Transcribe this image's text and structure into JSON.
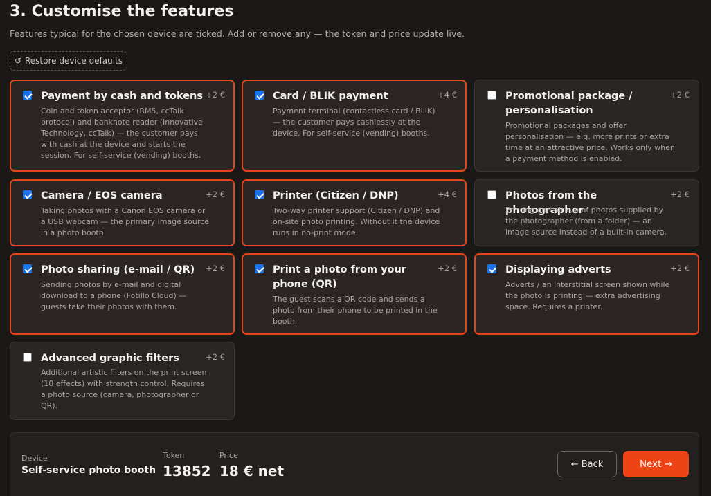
{
  "step": {
    "heading": "3. Customise the features",
    "subtitle": "Features typical for the chosen device are ticked. Add or remove any — the token and price update live.",
    "restore_label": "Restore device defaults"
  },
  "features": [
    {
      "title": "Payment by cash and tokens",
      "price": "+2 €",
      "checked": true,
      "desc": "Coin and token acceptor (RM5, ccTalk protocol) and banknote reader (Innovative Technology, ccTalk) — the customer pays with cash at the device and starts the session. For self-service (vending) booths."
    },
    {
      "title": "Card / BLIK payment",
      "price": "+4 €",
      "checked": true,
      "desc": "Payment terminal (contactless card / BLIK) — the customer pays cashlessly at the device. For self-service (vending) booths."
    },
    {
      "title": "Promotional package / personalisation",
      "price": "+2 €",
      "checked": false,
      "desc": "Promotional packages and offer personalisation — e.g. more prints or extra time at an attractive price. Works only when a payment method is enabled."
    },
    {
      "title": "Camera / EOS camera",
      "price": "+2 €",
      "checked": true,
      "desc": "Taking photos with a Canon EOS camera or a USB webcam — the primary image source in a photo booth."
    },
    {
      "title": "Printer (Citizen / DNP)",
      "price": "+4 €",
      "checked": true,
      "desc": "Two-way printer support (Citizen / DNP) and on-site photo printing. Without it the device runs in no-print mode."
    },
    {
      "title": "Photos from the photographer",
      "price": "+2 €",
      "checked": false,
      "desc": "Printing and pickup of photos supplied by the photographer (from a folder) — an image source instead of a built-in camera."
    },
    {
      "title": "Photo sharing (e-mail / QR)",
      "price": "+2 €",
      "checked": true,
      "desc": "Sending photos by e-mail and digital download to a phone (Fotillo Cloud) — guests take their photos with them."
    },
    {
      "title": "Print a photo from your phone (QR)",
      "price": "+2 €",
      "checked": true,
      "desc": "The guest scans a QR code and sends a photo from their phone to be printed in the booth."
    },
    {
      "title": "Displaying adverts",
      "price": "+2 €",
      "checked": true,
      "desc": "Adverts / an interstitial screen shown while the photo is printing — extra advertising space. Requires a printer."
    },
    {
      "title": "Advanced graphic filters",
      "price": "+2 €",
      "checked": false,
      "desc": "Additional artistic filters on the print screen (10 effects) with strength control. Requires a photo source (camera, photographer or QR)."
    }
  ],
  "summary": {
    "device_label": "Device",
    "device_value": "Self-service photo booth",
    "token_label": "Token",
    "token_value": "13852",
    "price_label": "Price",
    "price_value": "18 € net",
    "back_label": "← Back",
    "next_label": "Next →"
  },
  "colors": {
    "accent": "#ee4314",
    "selected_border": "#e4461b",
    "checkbox": "#1a73e8",
    "background": "#1b1918",
    "card": "#292624"
  }
}
